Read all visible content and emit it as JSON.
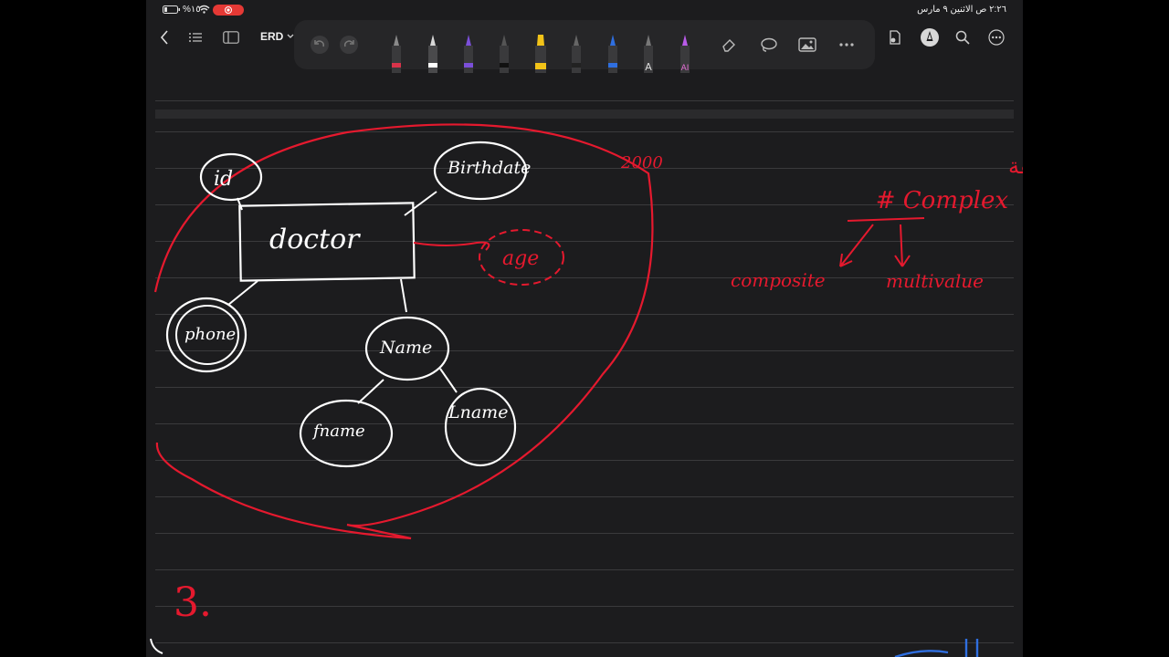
{
  "status_bar": {
    "battery": "%١٥",
    "datetime": "٢:٢٦ ص  الاثنين ٩ مارس"
  },
  "toolbar": {
    "back_icon": "chevron-left-icon",
    "doc_title": "ERD",
    "title_chevron_icon": "chevron-down-icon",
    "tools": [
      "undo-icon",
      "redo-icon",
      "fountain-pen",
      "ballpoint-pen",
      "purple-pen",
      "marker",
      "yellow-highlighter",
      "pencil",
      "blue-pen",
      "text-tool",
      "ai-pen",
      "eraser-icon",
      "lasso-icon",
      "image-icon",
      "more-icon"
    ],
    "right_icons": [
      "share-icon",
      "pen-mode-icon",
      "search-icon",
      "more-icon"
    ]
  },
  "canvas": {
    "colors": {
      "page": "#1c1c1e",
      "rule": "#3a3a3c",
      "ink_white": "#ffffff",
      "ink_red": "#e5192e",
      "ink_blue": "#2f6fe0"
    },
    "entity_label": "doctor",
    "attributes": [
      "id",
      "Birthdate",
      "age",
      "phone",
      "Name",
      "fname",
      "Lname"
    ],
    "annotations": [
      "2000",
      "# الصف المشتقة",
      "# Complex",
      "composite",
      "multivalue",
      "3."
    ]
  }
}
